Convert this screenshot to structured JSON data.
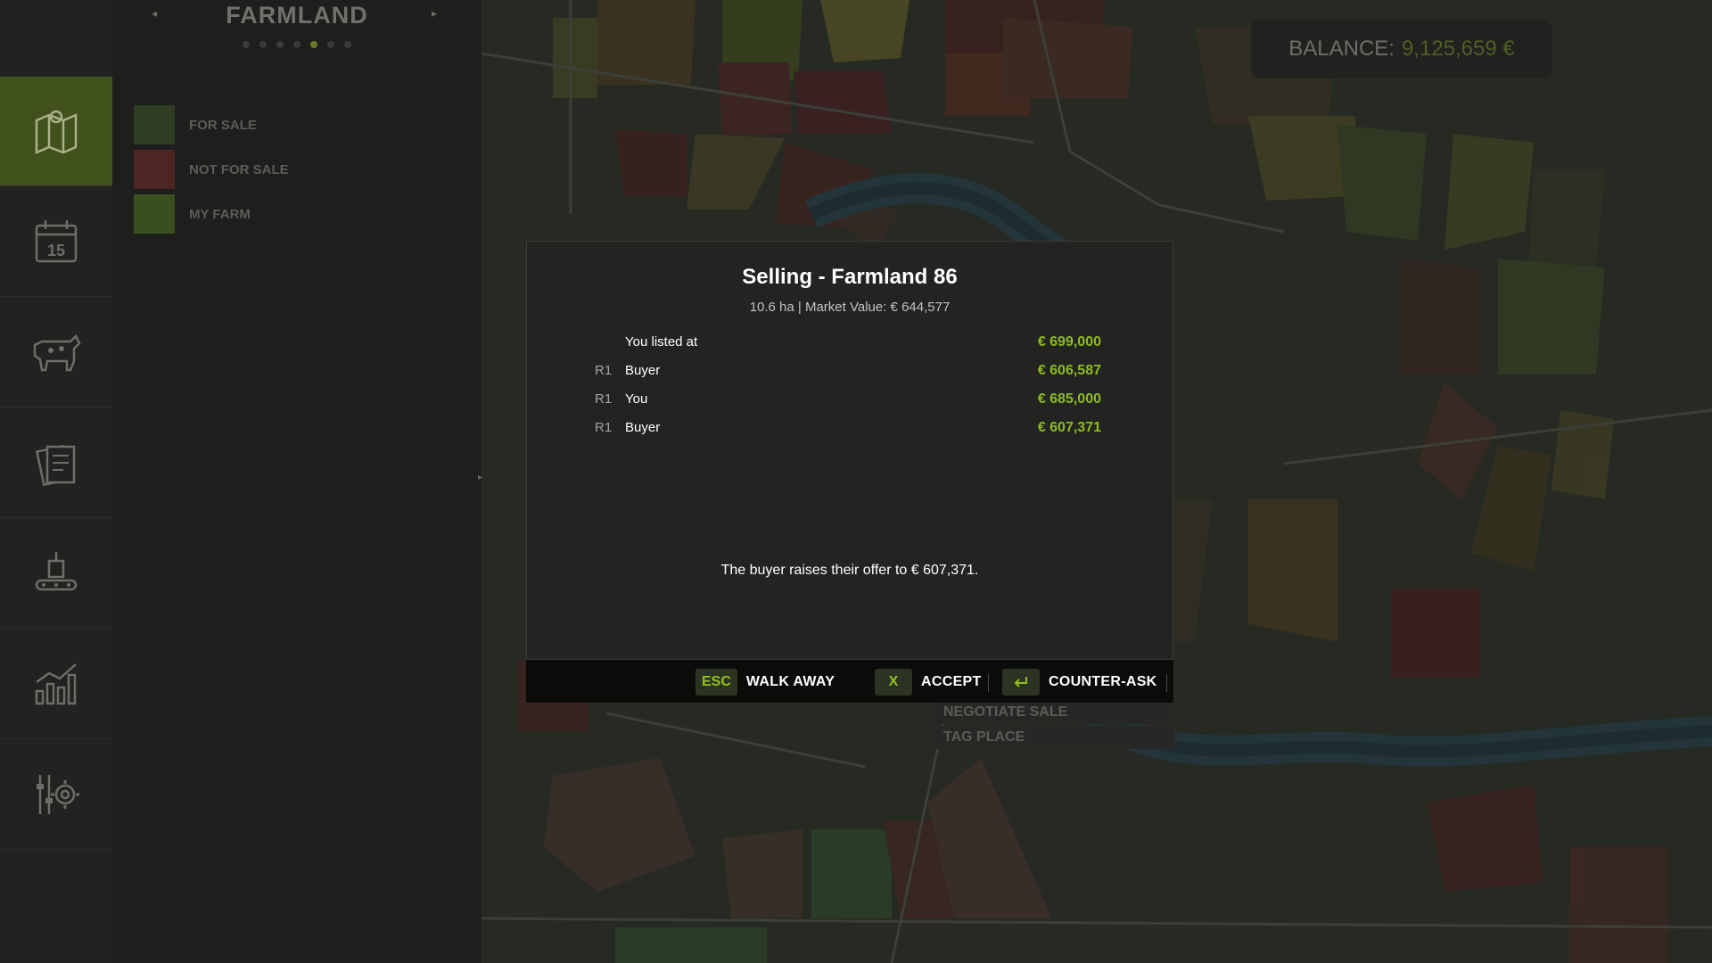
{
  "panel": {
    "title": "FARMLAND",
    "prev_arrow": "◂",
    "next_arrow": "▸",
    "page_count": 7,
    "active_page": 5,
    "legend": [
      {
        "label": "FOR SALE",
        "color": "#2f3d22"
      },
      {
        "label": "NOT FOR SALE",
        "color": "#4d2523"
      },
      {
        "label": "MY FARM",
        "color": "#3a4f1f"
      }
    ]
  },
  "nav": [
    {
      "name": "map-icon",
      "active": true
    },
    {
      "name": "calendar-icon",
      "label": "15"
    },
    {
      "name": "cow-icon"
    },
    {
      "name": "documents-icon"
    },
    {
      "name": "production-icon"
    },
    {
      "name": "statistics-icon"
    },
    {
      "name": "settings-icon"
    }
  ],
  "balance": {
    "label": "BALANCE:",
    "value": "9,125,659 €"
  },
  "context_menu": [
    "NEGOTIATE SALE",
    "TAG PLACE"
  ],
  "modal": {
    "title": "Selling - Farmland 86",
    "subtitle": "10.6 ha  |  Market Value: € 644,577",
    "offers": [
      {
        "round": "",
        "party": "You listed at",
        "amount": "€ 699,000"
      },
      {
        "round": "R1",
        "party": "Buyer",
        "amount": "€ 606,587"
      },
      {
        "round": "R1",
        "party": "You",
        "amount": "€ 685,000"
      },
      {
        "round": "R1",
        "party": "Buyer",
        "amount": "€ 607,371"
      }
    ],
    "message": "The buyer raises their offer to € 607,371."
  },
  "actions": {
    "walk_away": {
      "key": "ESC",
      "label": "WALK AWAY"
    },
    "accept": {
      "key": "X",
      "label": "ACCEPT"
    },
    "counter": {
      "key_icon": "enter-icon",
      "label": "COUNTER-ASK"
    }
  },
  "colors": {
    "accent": "#8dbb20",
    "panel_bg": "#1e1f1d",
    "modal_bg": "#232421"
  }
}
